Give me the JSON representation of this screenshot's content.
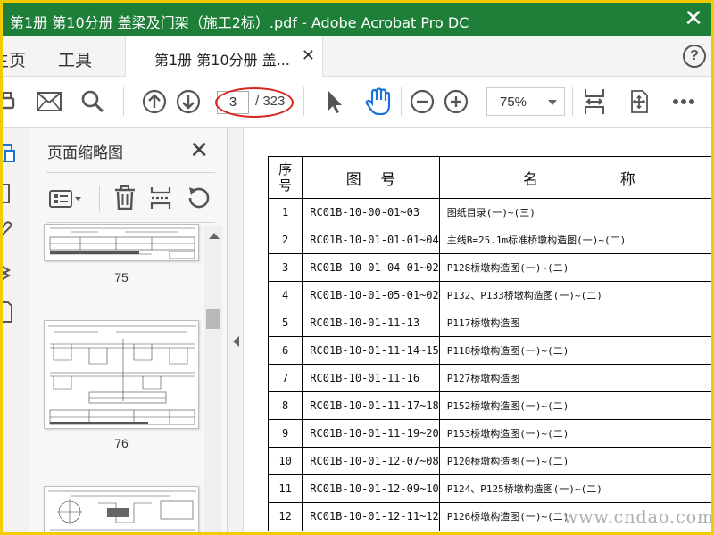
{
  "window": {
    "title": "第1册 第10分册 盖梁及门架（施工2标）.pdf - Adobe Acrobat Pro DC",
    "close_glyph": "✕"
  },
  "nav": {
    "home_label": "主页",
    "tools_label": "工具"
  },
  "tab": {
    "label": "第1册 第10分册 盖...",
    "close_glyph": "✕"
  },
  "help_glyph": "?",
  "toolbar": {
    "page_current": "3",
    "page_total": "/ 323",
    "zoom": "75%",
    "icons": [
      "print-icon",
      "email-icon",
      "search-icon",
      "previous-page-icon",
      "next-page-icon",
      "select-cursor-icon",
      "hand-tool-icon",
      "zoom-out-icon",
      "zoom-in-icon",
      "fit-width-icon",
      "full-screen-icon",
      "more-icon"
    ],
    "hand_color": "#1a73d9",
    "annotation_color": "#d8231e"
  },
  "thumbnail_panel": {
    "title": "页面缩略图",
    "close_glyph": "✕",
    "thumbnails": [
      {
        "page_label": "75"
      },
      {
        "page_label": "76"
      },
      {
        "page_label": ""
      }
    ]
  },
  "document": {
    "header": {
      "col1": "序号",
      "col2": "图    号",
      "col3": "名                 称"
    },
    "rows": [
      {
        "no": "1",
        "code": "RC01B-10-00-01~03",
        "name": "图纸目录(一)~(三)"
      },
      {
        "no": "2",
        "code": "RC01B-10-01-01-01~04",
        "name": "主线B=25.1m标准桥墩构造图(一)~(二)"
      },
      {
        "no": "3",
        "code": "RC01B-10-01-04-01~02",
        "name": "P128桥墩构造图(一)~(二)"
      },
      {
        "no": "4",
        "code": "RC01B-10-01-05-01~02",
        "name": "P132、P133桥墩构造图(一)~(二)"
      },
      {
        "no": "5",
        "code": "RC01B-10-01-11-13",
        "name": "P117桥墩构造图"
      },
      {
        "no": "6",
        "code": "RC01B-10-01-11-14~15",
        "name": "P118桥墩构造图(一)~(二)"
      },
      {
        "no": "7",
        "code": "RC01B-10-01-11-16",
        "name": "P127桥墩构造图"
      },
      {
        "no": "8",
        "code": "RC01B-10-01-11-17~18",
        "name": "P152桥墩构造图(一)~(二)"
      },
      {
        "no": "9",
        "code": "RC01B-10-01-11-19~20",
        "name": "P153桥墩构造图(一)~(二)"
      },
      {
        "no": "10",
        "code": "RC01B-10-01-12-07~08",
        "name": "P120桥墩构造图(一)~(二)"
      },
      {
        "no": "11",
        "code": "RC01B-10-01-12-09~10",
        "name": "P124、P125桥墩构造图(一)~(二)"
      },
      {
        "no": "12",
        "code": "RC01B-10-01-12-11~12",
        "name": "P126桥墩构造图(一)~(二)"
      }
    ]
  },
  "watermark": "www.cndao.com",
  "colors": {
    "titlebar": "#1e7f38",
    "frame": "#f2cb00"
  }
}
